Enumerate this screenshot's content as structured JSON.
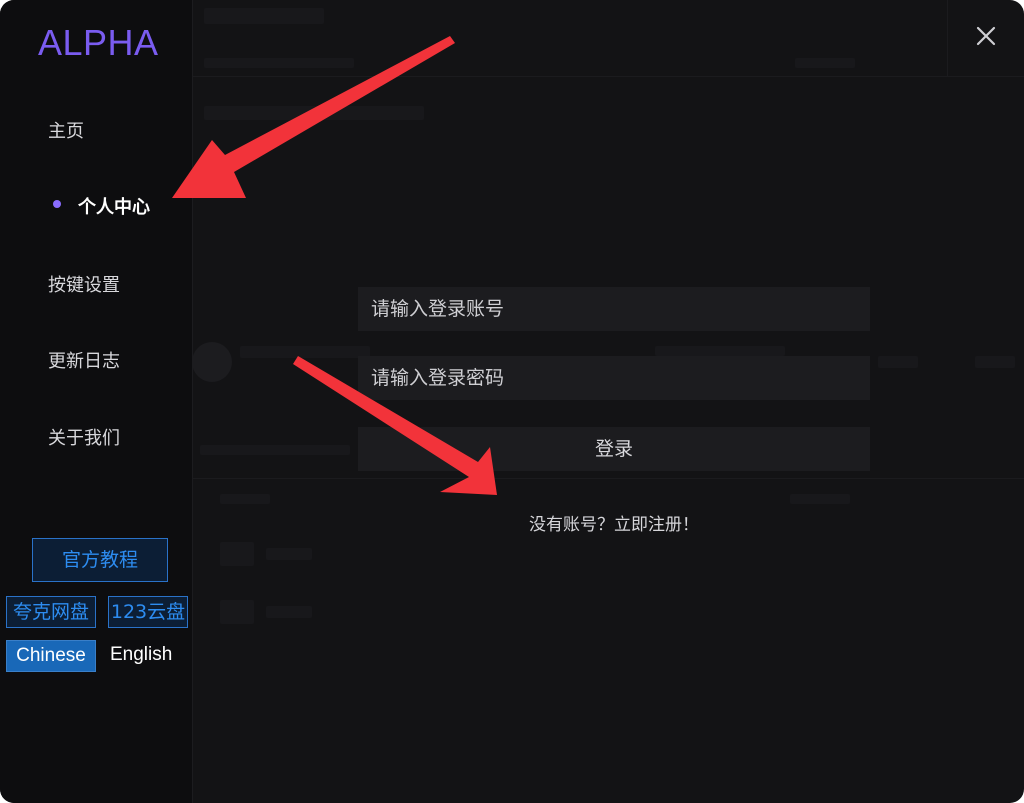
{
  "app": {
    "logo": "ALPHA"
  },
  "sidebar": {
    "items": [
      {
        "label": "主页",
        "active": false
      },
      {
        "label": "个人中心",
        "active": true
      },
      {
        "label": "按键设置",
        "active": false
      },
      {
        "label": "更新日志",
        "active": false
      },
      {
        "label": "关于我们",
        "active": false
      }
    ],
    "tutorial_button": "官方教程",
    "links": [
      "夸克网盘",
      "123云盘"
    ],
    "languages": {
      "selected": "Chinese",
      "other": "English"
    }
  },
  "login": {
    "account_placeholder": "请输入登录账号",
    "password_placeholder": "请输入登录密码",
    "login_button": "登录",
    "register_link": "没有账号？立即注册！"
  },
  "colors": {
    "accent": "#7a5cf0",
    "link_blue": "#2d8cf0",
    "annotation_arrow": "#f2333a"
  },
  "icons": {
    "close": "close-icon"
  }
}
